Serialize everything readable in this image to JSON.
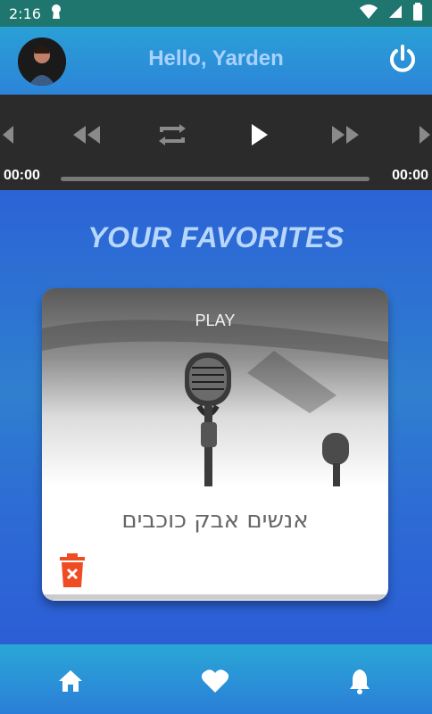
{
  "status_bar": {
    "time": "2:16"
  },
  "appbar": {
    "greeting": "Hello, Yarden",
    "avatar_icon": "user-avatar",
    "power_icon": "power-icon"
  },
  "player": {
    "time_start": "00:00",
    "time_end": "00:00",
    "progress": 0
  },
  "favorites": {
    "section_title": "YOUR FAVORITES",
    "cards": [
      {
        "play_label": "PLAY",
        "song_title": "אנשים אבק כוכבים",
        "delete_icon": "trash-icon"
      }
    ]
  },
  "bottom_nav": {
    "items": [
      {
        "icon": "home-icon"
      },
      {
        "icon": "heart-icon"
      },
      {
        "icon": "bell-icon"
      }
    ]
  },
  "colors": {
    "accent": "#2c84d8",
    "status_bar": "#1f766f",
    "player_bg": "#2b2b2b",
    "delete": "#f04c24"
  }
}
